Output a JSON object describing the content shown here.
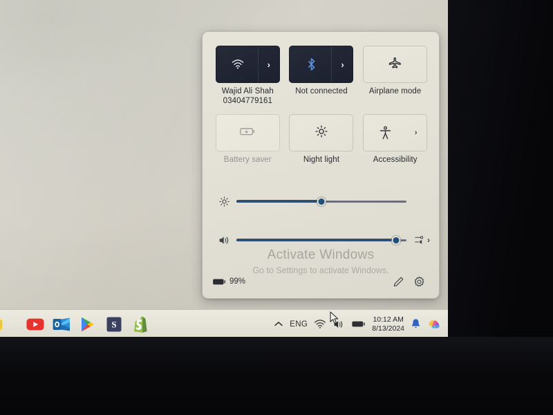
{
  "screen": {
    "desktop_background_color": "#cfccc1",
    "device_note": "laptop-screen-photo"
  },
  "quick_settings": {
    "tiles": [
      {
        "name": "wifi",
        "icon": "wifi-icon",
        "state": "on",
        "has_chevron": true,
        "label_line1": "Wajid Ali Shah",
        "label_line2": "03404779161"
      },
      {
        "name": "bluetooth",
        "icon": "bluetooth-icon",
        "state": "on",
        "has_chevron": true,
        "label_line1": "Not connected",
        "label_line2": ""
      },
      {
        "name": "airplane-mode",
        "icon": "airplane-icon",
        "state": "off",
        "has_chevron": false,
        "label_line1": "Airplane mode",
        "label_line2": ""
      },
      {
        "name": "battery-saver",
        "icon": "battery-saver-icon",
        "state": "disabled",
        "has_chevron": false,
        "label_line1": "Battery saver",
        "label_line2": ""
      },
      {
        "name": "night-light",
        "icon": "brightness-icon",
        "state": "off",
        "has_chevron": false,
        "label_line1": "Night light",
        "label_line2": ""
      },
      {
        "name": "accessibility",
        "icon": "accessibility-icon",
        "state": "off",
        "has_chevron": true,
        "label_line1": "Accessibility",
        "label_line2": ""
      }
    ],
    "brightness": {
      "icon": "brightness-icon",
      "value_percent": 50
    },
    "volume": {
      "icon": "speaker-icon",
      "value_percent": 94,
      "output_selector_icon": "audio-output-icon",
      "output_selector_chevron": "›"
    },
    "footer": {
      "battery_icon": "battery-icon",
      "battery_percent": "99%",
      "edit_icon": "pencil-edit-icon",
      "settings_icon": "gear-icon"
    }
  },
  "watermark": {
    "line1": "Activate Windows",
    "line2": "Go to Settings to activate Windows."
  },
  "taskbar": {
    "apps": [
      {
        "name": "app-partial-yellow",
        "glyph": ""
      },
      {
        "name": "youtube",
        "glyph": "▶"
      },
      {
        "name": "outlook",
        "glyph": "O"
      },
      {
        "name": "google-play",
        "glyph": "▶"
      },
      {
        "name": "app-s-dark",
        "glyph": "S"
      },
      {
        "name": "shopify",
        "glyph": "S"
      }
    ],
    "tray": {
      "overflow_chevron": "⌃",
      "language": "ENG",
      "wifi_icon": "wifi-icon",
      "volume_icon": "speaker-icon",
      "battery_icon": "battery-icon",
      "clock_time": "10:12 AM",
      "clock_date": "8/13/2024",
      "notification_icon": "bell-icon",
      "copilot_icon": "copilot-icon"
    }
  },
  "colors": {
    "panel_bg": "#e4e2d6",
    "tile_on": "#222734",
    "accent_blue": "#1f4f7a",
    "text_dark": "#22242a",
    "text_muted": "#8e8e90"
  }
}
